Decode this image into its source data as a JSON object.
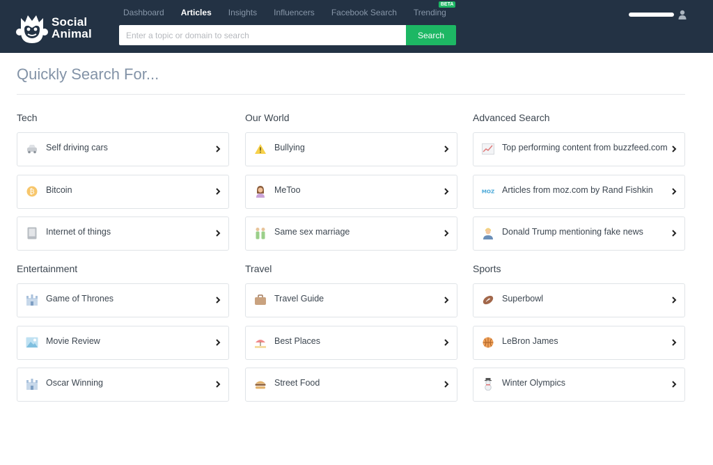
{
  "app": {
    "logo_line1": "Social",
    "logo_line2": "Animal"
  },
  "nav": [
    {
      "label": "Dashboard"
    },
    {
      "label": "Articles"
    },
    {
      "label": "Insights"
    },
    {
      "label": "Influencers"
    },
    {
      "label": "Facebook Search"
    },
    {
      "label": "Trending",
      "badge": "BETA"
    }
  ],
  "search": {
    "placeholder": "Enter a topic or domain to search",
    "button_label": "Search"
  },
  "page": {
    "title": "Quickly Search For..."
  },
  "sections": [
    {
      "title": "Tech",
      "items": [
        {
          "label": "Self driving cars",
          "icon": "car-icon"
        },
        {
          "label": "Bitcoin",
          "icon": "bitcoin-icon"
        },
        {
          "label": "Internet of things",
          "icon": "device-icon"
        }
      ]
    },
    {
      "title": "Our World",
      "items": [
        {
          "label": "Bullying",
          "icon": "warning-icon"
        },
        {
          "label": "MeToo",
          "icon": "woman-icon"
        },
        {
          "label": "Same sex marriage",
          "icon": "couple-icon"
        }
      ]
    },
    {
      "title": "Advanced Search",
      "items": [
        {
          "label": "Top performing content from buzzfeed.com",
          "icon": "trend-chart-icon"
        },
        {
          "label": "Articles from moz.com by Rand Fishkin",
          "icon": "moz-logo-icon"
        },
        {
          "label": "Donald Trump mentioning fake news",
          "icon": "person-icon"
        }
      ]
    },
    {
      "title": "Entertainment",
      "items": [
        {
          "label": "Game of Thrones",
          "icon": "castle-icon"
        },
        {
          "label": "Movie Review",
          "icon": "picture-icon"
        },
        {
          "label": "Oscar Winning",
          "icon": "castle-icon"
        }
      ]
    },
    {
      "title": "Travel",
      "items": [
        {
          "label": "Travel Guide",
          "icon": "suitcase-icon"
        },
        {
          "label": "Best Places",
          "icon": "beach-icon"
        },
        {
          "label": "Street Food",
          "icon": "burger-icon"
        }
      ]
    },
    {
      "title": "Sports",
      "items": [
        {
          "label": "Superbowl",
          "icon": "football-icon"
        },
        {
          "label": "LeBron James",
          "icon": "basketball-icon"
        },
        {
          "label": "Winter Olympics",
          "icon": "snowman-icon"
        }
      ]
    }
  ]
}
